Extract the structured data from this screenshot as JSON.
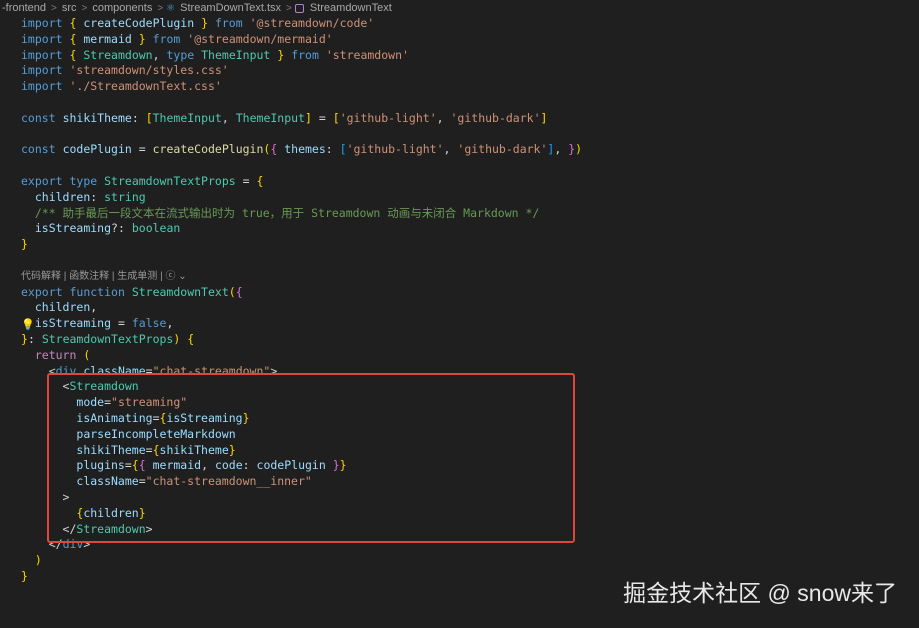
{
  "breadcrumb": {
    "segments": [
      "-frontend",
      "src",
      "components",
      "StreamDownText.tsx",
      "StreamdownText"
    ],
    "separator": ">"
  },
  "codelens": {
    "text": "代码解释 | 函数注释 | 生成单测 | ⓒ ⌄"
  },
  "code_lines": [
    "import { createCodePlugin } from '@streamdown/code'",
    "import { mermaid } from '@streamdown/mermaid'",
    "import { Streamdown, type ThemeInput } from 'streamdown'",
    "import 'streamdown/styles.css'",
    "import './StreamdownText.css'",
    "",
    "const shikiTheme: [ThemeInput, ThemeInput] = ['github-light', 'github-dark']",
    "",
    "const codePlugin = createCodePlugin({ themes: ['github-light', 'github-dark'], })",
    "",
    "export type StreamdownTextProps = {",
    "  children: string",
    "  /** 助手最后一段文本在流式输出时为 true，用于 Streamdown 动画与未闭合 Markdown */",
    "  isStreaming?: boolean",
    "}",
    "",
    "export function StreamdownText({",
    "  children,",
    "  isStreaming = false,",
    "}: StreamdownTextProps) {",
    "  return (",
    "    <div className=\"chat-streamdown\">",
    "      <Streamdown",
    "        mode=\"streaming\"",
    "        isAnimating={isStreaming}",
    "        parseIncompleteMarkdown",
    "        shikiTheme={shikiTheme}",
    "        plugins={{ mermaid, code: codePlugin }}",
    "        className=\"chat-streamdown__inner\"",
    "      >",
    "        {children}",
    "      </Streamdown>",
    "    </div>",
    "  )",
    "}"
  ],
  "watermark": "掘金技术社区 @ snow来了",
  "colors": {
    "background": "#1f1f1f",
    "highlight_border": "#e0453f",
    "keyword": "#569cd6",
    "string": "#ce9178"
  }
}
